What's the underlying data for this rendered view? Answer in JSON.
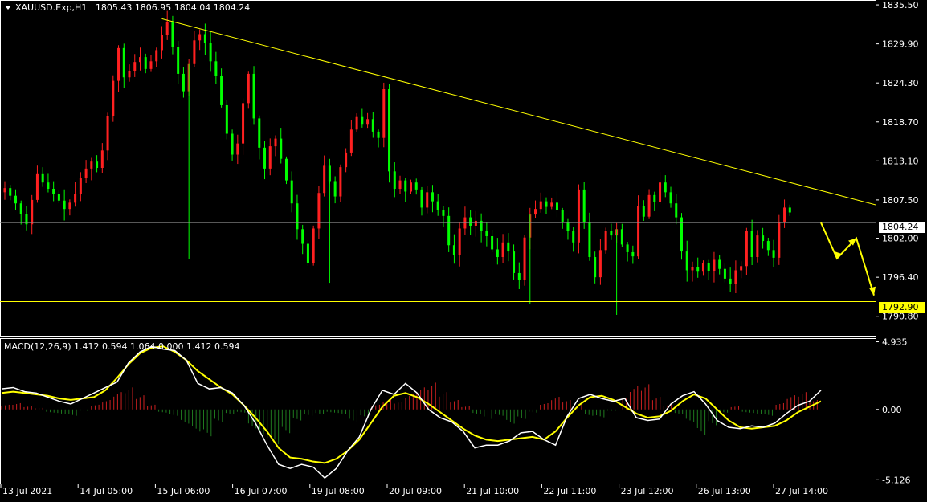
{
  "header": {
    "symbol": "XAUUSD.Exp,H1",
    "ohlc": "1805.43 1806.95 1804.04 1804.24"
  },
  "macd_header": {
    "label": "MACD(12,26,9) 1.412 0.594 1.064 0.000 1.412 0.594"
  },
  "price_tags": {
    "current": "1804.24",
    "support": "1792.90"
  },
  "colors": {
    "background": "#000000",
    "bull_candle": "#ff2020",
    "bear_candle": "#00ff00",
    "trendline": "#ffff00",
    "macd_line": "#ffffff",
    "signal_line": "#ffff00",
    "hist_positive": "#cc2020",
    "hist_negative": "#1f7a1f",
    "axis": "#ffffff"
  },
  "chart_data": [
    {
      "type": "candlestick",
      "panel": "price",
      "symbol": "XAUUSD.Exp",
      "timeframe": "H1",
      "ylim": [
        1788.0,
        1836.2
      ],
      "yticks": [
        "1835.50",
        "1829.90",
        "1824.30",
        "1818.70",
        "1813.10",
        "1807.50",
        "1802.00",
        "1796.40",
        "1790.80"
      ],
      "xticks": [
        "13 Jul 2021",
        "14 Jul 05:00",
        "15 Jul 06:00",
        "16 Jul 07:00",
        "19 Jul 08:00",
        "20 Jul 09:00",
        "21 Jul 10:00",
        "22 Jul 11:00",
        "23 Jul 12:00",
        "26 Jul 13:00",
        "27 Jul 14:00"
      ],
      "current_price": 1804.24,
      "support_level": 1792.9,
      "trendline": {
        "from": {
          "x": "15 Jul 06:00",
          "y": 1833.5
        },
        "to": {
          "x": "end",
          "y": 1806.8
        }
      },
      "forecast_path": [
        1804.24,
        1799.1,
        1802.0,
        1793.8
      ],
      "close_path": [
        1809.2,
        1808.1,
        1807.0,
        1805.5,
        1804.0,
        1807.5,
        1811.2,
        1810.0,
        1809.1,
        1808.3,
        1807.4,
        1806.2,
        1807.1,
        1808.4,
        1810.6,
        1812.0,
        1813.0,
        1812.1,
        1814.6,
        1819.5,
        1824.6,
        1829.3,
        1825.1,
        1826.0,
        1827.3,
        1828.0,
        1826.3,
        1827.4,
        1829.0,
        1831.2,
        1833.0,
        1829.4,
        1825.6,
        1823.1,
        1827.0,
        1830.4,
        1831.3,
        1830.0,
        1827.4,
        1825.3,
        1821.1,
        1817.0,
        1814.0,
        1815.6,
        1821.4,
        1825.6,
        1819.2,
        1815.0,
        1812.0,
        1815.2,
        1816.3,
        1813.4,
        1810.3,
        1807.0,
        1803.3,
        1801.2,
        1798.4,
        1803.4,
        1808.5,
        1812.4,
        1810.2,
        1808.0,
        1812.2,
        1814.3,
        1817.6,
        1819.4,
        1818.3,
        1819.1,
        1817.3,
        1816.4,
        1823.4,
        1811.6,
        1809.1,
        1810.3,
        1808.7,
        1810.0,
        1809.0,
        1806.4,
        1808.6,
        1807.3,
        1806.1,
        1805.2,
        1801.0,
        1799.6,
        1803.4,
        1805.0,
        1803.8,
        1804.5,
        1803.1,
        1802.3,
        1800.4,
        1799.3,
        1801.4,
        1800.1,
        1797.0,
        1796.0,
        1802.1,
        1805.4,
        1806.2,
        1807.3,
        1806.5,
        1807.1,
        1806.0,
        1804.2,
        1803.0,
        1801.4,
        1809.0,
        1804.2,
        1799.3,
        1796.4,
        1800.3,
        1803.1,
        1802.4,
        1803.3,
        1801.1,
        1800.0,
        1799.4,
        1806.6,
        1805.1,
        1808.2,
        1807.2,
        1810.0,
        1808.6,
        1807.0,
        1805.0,
        1800.1,
        1797.4,
        1797.8,
        1797.2,
        1798.4,
        1797.3,
        1798.9,
        1797.6,
        1796.2,
        1795.4,
        1797.4,
        1798.0,
        1803.0,
        1799.3,
        1802.4,
        1801.6,
        1800.3,
        1799.2,
        1804.3,
        1806.4,
        1805.7
      ]
    },
    {
      "type": "macd",
      "panel": "indicator",
      "params": [
        12,
        26,
        9
      ],
      "ylim": [
        -5.4,
        5.2
      ],
      "yticks": [
        "4.935",
        "0.00",
        "-5.126"
      ],
      "macd_line": [
        1.5,
        1.6,
        1.3,
        1.2,
        0.9,
        0.6,
        0.4,
        0.8,
        1.2,
        1.6,
        2.0,
        3.4,
        4.2,
        4.6,
        4.4,
        4.3,
        3.6,
        1.9,
        1.5,
        1.6,
        1.2,
        0.3,
        -1.0,
        -2.6,
        -4.0,
        -4.3,
        -4.0,
        -4.2,
        -5.0,
        -4.3,
        -3.0,
        -2.0,
        0.0,
        1.4,
        1.1,
        1.9,
        1.2,
        0.0,
        -0.6,
        -0.9,
        -1.6,
        -2.8,
        -2.6,
        -2.6,
        -2.3,
        -1.7,
        -1.6,
        -2.2,
        -2.6,
        -0.5,
        0.8,
        1.1,
        0.8,
        0.6,
        0.8,
        -0.6,
        -0.8,
        -0.7,
        0.4,
        1.0,
        1.3,
        0.4,
        -0.8,
        -1.3,
        -1.4,
        -1.2,
        -1.3,
        -1.0,
        -0.3,
        0.3,
        0.6,
        1.4
      ],
      "signal_line": [
        1.2,
        1.3,
        1.2,
        1.1,
        1.0,
        0.8,
        0.7,
        0.8,
        0.9,
        1.4,
        2.3,
        3.3,
        4.1,
        4.5,
        4.6,
        4.2,
        3.6,
        2.8,
        2.2,
        1.6,
        1.1,
        0.3,
        -0.6,
        -1.6,
        -2.8,
        -3.5,
        -3.6,
        -3.8,
        -3.9,
        -3.6,
        -3.0,
        -2.2,
        -1.0,
        0.2,
        1.0,
        1.2,
        0.9,
        0.4,
        -0.2,
        -0.8,
        -1.4,
        -1.9,
        -2.2,
        -2.3,
        -2.2,
        -2.1,
        -2.0,
        -2.2,
        -1.6,
        -0.6,
        0.3,
        0.9,
        1.0,
        0.7,
        0.2,
        -0.3,
        -0.6,
        -0.5,
        -0.1,
        0.6,
        1.1,
        0.8,
        0.0,
        -0.8,
        -1.3,
        -1.4,
        -1.3,
        -1.2,
        -0.8,
        -0.2,
        0.2,
        0.6
      ],
      "histogram": [
        0.3,
        0.4,
        0.2,
        0.1,
        -0.2,
        -0.3,
        -0.4,
        -0.1,
        0.3,
        0.6,
        1.1,
        1.4,
        0.9,
        0.3,
        -0.2,
        -0.4,
        -0.9,
        -1.4,
        -1.7,
        -0.8,
        -0.3,
        -0.2,
        -1.2,
        -1.8,
        -2.2,
        -1.5,
        -0.7,
        -0.4,
        -0.3,
        -0.2,
        -0.3,
        -0.8,
        -0.5,
        0.3,
        0.6,
        0.5,
        1.0,
        1.4,
        1.7,
        1.1,
        0.6,
        0.2,
        -0.3,
        -0.6,
        -0.4,
        -0.9,
        -0.6,
        -0.2,
        0.4,
        0.8,
        0.6,
        0.3,
        -0.4,
        -0.5,
        -0.1,
        0.7,
        1.5,
        1.6,
        0.8,
        0.3,
        -0.3,
        -0.8,
        -1.6,
        -1.0,
        -0.2,
        0.2,
        -0.2,
        -0.3,
        -0.4,
        0.4,
        0.9,
        1.1,
        0.6
      ]
    }
  ]
}
